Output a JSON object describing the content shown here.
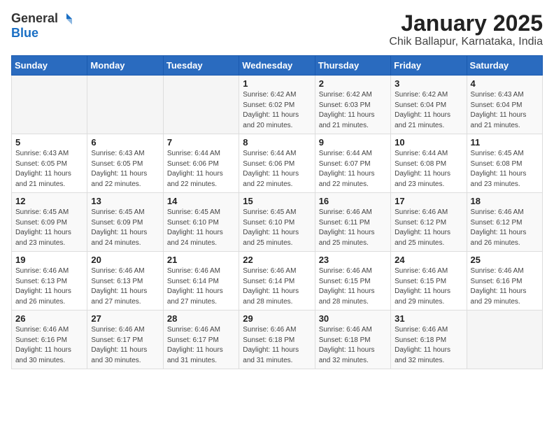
{
  "logo": {
    "general": "General",
    "blue": "Blue"
  },
  "title": "January 2025",
  "location": "Chik Ballapur, Karnataka, India",
  "days_of_week": [
    "Sunday",
    "Monday",
    "Tuesday",
    "Wednesday",
    "Thursday",
    "Friday",
    "Saturday"
  ],
  "weeks": [
    [
      {
        "day": "",
        "info": ""
      },
      {
        "day": "",
        "info": ""
      },
      {
        "day": "",
        "info": ""
      },
      {
        "day": "1",
        "info": "Sunrise: 6:42 AM\nSunset: 6:02 PM\nDaylight: 11 hours\nand 20 minutes."
      },
      {
        "day": "2",
        "info": "Sunrise: 6:42 AM\nSunset: 6:03 PM\nDaylight: 11 hours\nand 21 minutes."
      },
      {
        "day": "3",
        "info": "Sunrise: 6:42 AM\nSunset: 6:04 PM\nDaylight: 11 hours\nand 21 minutes."
      },
      {
        "day": "4",
        "info": "Sunrise: 6:43 AM\nSunset: 6:04 PM\nDaylight: 11 hours\nand 21 minutes."
      }
    ],
    [
      {
        "day": "5",
        "info": "Sunrise: 6:43 AM\nSunset: 6:05 PM\nDaylight: 11 hours\nand 21 minutes."
      },
      {
        "day": "6",
        "info": "Sunrise: 6:43 AM\nSunset: 6:05 PM\nDaylight: 11 hours\nand 22 minutes."
      },
      {
        "day": "7",
        "info": "Sunrise: 6:44 AM\nSunset: 6:06 PM\nDaylight: 11 hours\nand 22 minutes."
      },
      {
        "day": "8",
        "info": "Sunrise: 6:44 AM\nSunset: 6:06 PM\nDaylight: 11 hours\nand 22 minutes."
      },
      {
        "day": "9",
        "info": "Sunrise: 6:44 AM\nSunset: 6:07 PM\nDaylight: 11 hours\nand 22 minutes."
      },
      {
        "day": "10",
        "info": "Sunrise: 6:44 AM\nSunset: 6:08 PM\nDaylight: 11 hours\nand 23 minutes."
      },
      {
        "day": "11",
        "info": "Sunrise: 6:45 AM\nSunset: 6:08 PM\nDaylight: 11 hours\nand 23 minutes."
      }
    ],
    [
      {
        "day": "12",
        "info": "Sunrise: 6:45 AM\nSunset: 6:09 PM\nDaylight: 11 hours\nand 23 minutes."
      },
      {
        "day": "13",
        "info": "Sunrise: 6:45 AM\nSunset: 6:09 PM\nDaylight: 11 hours\nand 24 minutes."
      },
      {
        "day": "14",
        "info": "Sunrise: 6:45 AM\nSunset: 6:10 PM\nDaylight: 11 hours\nand 24 minutes."
      },
      {
        "day": "15",
        "info": "Sunrise: 6:45 AM\nSunset: 6:10 PM\nDaylight: 11 hours\nand 25 minutes."
      },
      {
        "day": "16",
        "info": "Sunrise: 6:46 AM\nSunset: 6:11 PM\nDaylight: 11 hours\nand 25 minutes."
      },
      {
        "day": "17",
        "info": "Sunrise: 6:46 AM\nSunset: 6:12 PM\nDaylight: 11 hours\nand 25 minutes."
      },
      {
        "day": "18",
        "info": "Sunrise: 6:46 AM\nSunset: 6:12 PM\nDaylight: 11 hours\nand 26 minutes."
      }
    ],
    [
      {
        "day": "19",
        "info": "Sunrise: 6:46 AM\nSunset: 6:13 PM\nDaylight: 11 hours\nand 26 minutes."
      },
      {
        "day": "20",
        "info": "Sunrise: 6:46 AM\nSunset: 6:13 PM\nDaylight: 11 hours\nand 27 minutes."
      },
      {
        "day": "21",
        "info": "Sunrise: 6:46 AM\nSunset: 6:14 PM\nDaylight: 11 hours\nand 27 minutes."
      },
      {
        "day": "22",
        "info": "Sunrise: 6:46 AM\nSunset: 6:14 PM\nDaylight: 11 hours\nand 28 minutes."
      },
      {
        "day": "23",
        "info": "Sunrise: 6:46 AM\nSunset: 6:15 PM\nDaylight: 11 hours\nand 28 minutes."
      },
      {
        "day": "24",
        "info": "Sunrise: 6:46 AM\nSunset: 6:15 PM\nDaylight: 11 hours\nand 29 minutes."
      },
      {
        "day": "25",
        "info": "Sunrise: 6:46 AM\nSunset: 6:16 PM\nDaylight: 11 hours\nand 29 minutes."
      }
    ],
    [
      {
        "day": "26",
        "info": "Sunrise: 6:46 AM\nSunset: 6:16 PM\nDaylight: 11 hours\nand 30 minutes."
      },
      {
        "day": "27",
        "info": "Sunrise: 6:46 AM\nSunset: 6:17 PM\nDaylight: 11 hours\nand 30 minutes."
      },
      {
        "day": "28",
        "info": "Sunrise: 6:46 AM\nSunset: 6:17 PM\nDaylight: 11 hours\nand 31 minutes."
      },
      {
        "day": "29",
        "info": "Sunrise: 6:46 AM\nSunset: 6:18 PM\nDaylight: 11 hours\nand 31 minutes."
      },
      {
        "day": "30",
        "info": "Sunrise: 6:46 AM\nSunset: 6:18 PM\nDaylight: 11 hours\nand 32 minutes."
      },
      {
        "day": "31",
        "info": "Sunrise: 6:46 AM\nSunset: 6:18 PM\nDaylight: 11 hours\nand 32 minutes."
      },
      {
        "day": "",
        "info": ""
      }
    ]
  ]
}
